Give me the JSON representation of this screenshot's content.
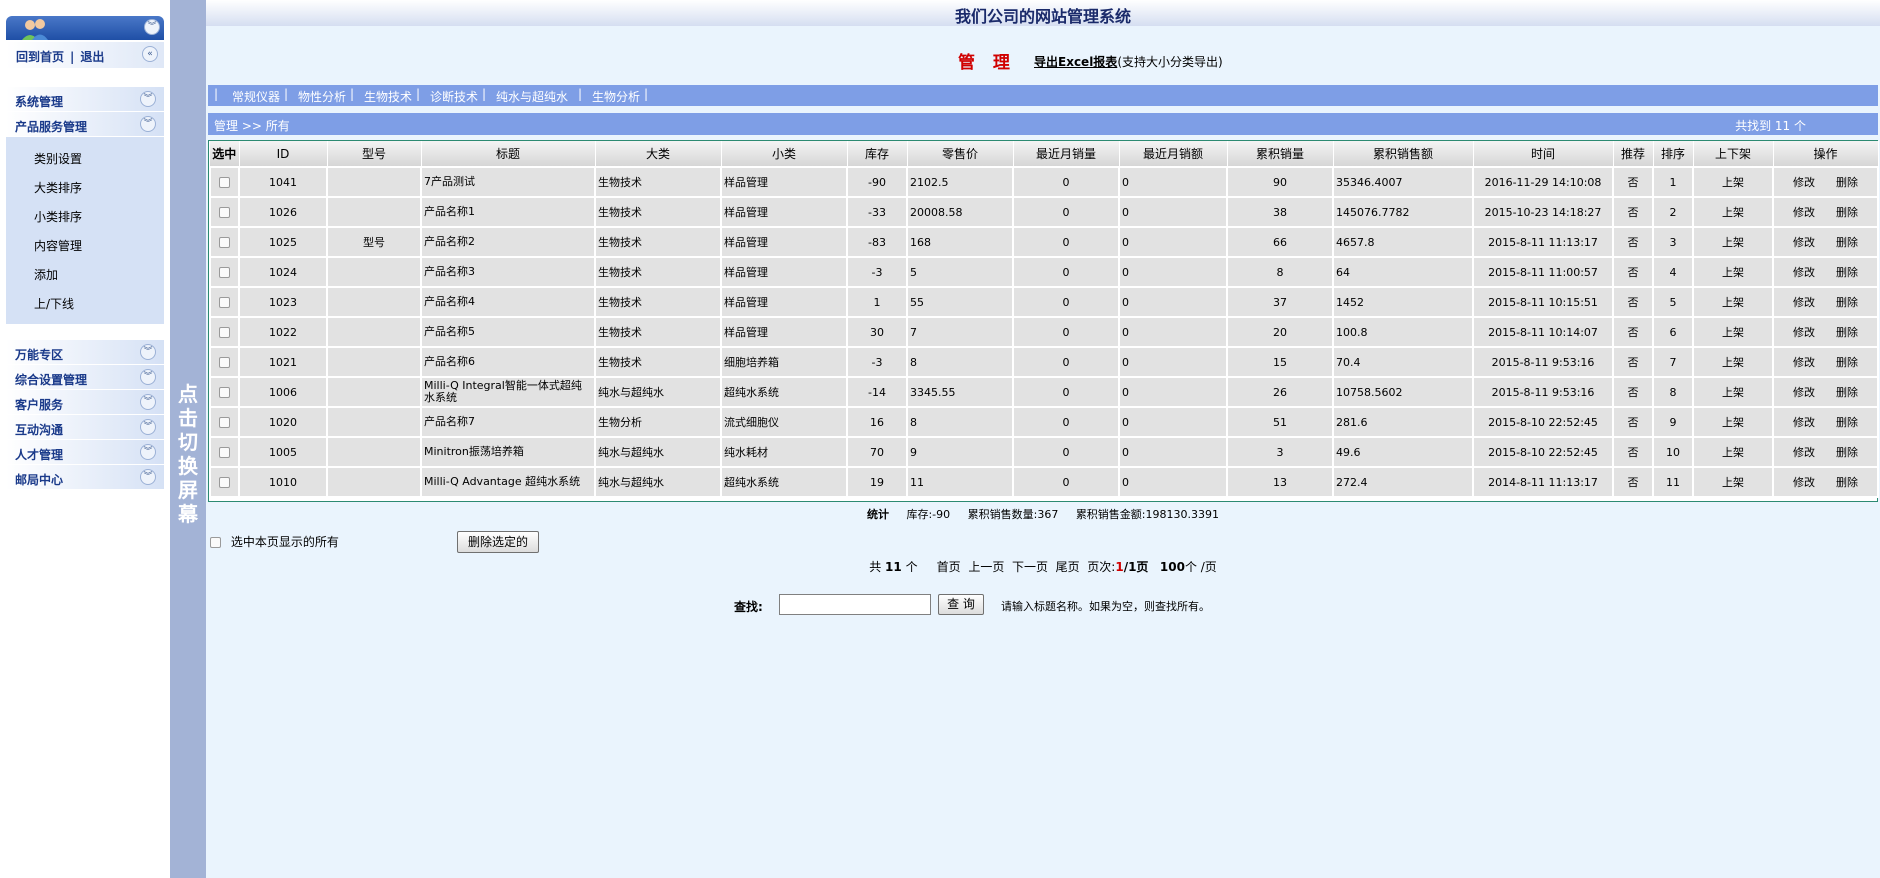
{
  "sidebar": {
    "home_link": "回到首页",
    "logout_link": "退出",
    "divider": "|",
    "menus_top": [
      "系统管理",
      "产品服务管理"
    ],
    "sub_items": [
      "类别设置",
      "大类排序",
      "小类排序",
      "内容管理",
      "添加",
      "上/下线"
    ],
    "menus_bottom": [
      "万能专区",
      "综合设置管理",
      "客户服务",
      "互动沟通",
      "人才管理",
      "邮局中心"
    ]
  },
  "toggle_bar": {
    "text": "点击切换屏幕"
  },
  "site_title": "我们公司的网站管理系统",
  "page_head": {
    "title": "管 理",
    "excel_link": "导出Excel报表",
    "excel_note": "(支持大小分类导出)"
  },
  "categories": [
    "常规仪器",
    "物性分析",
    "生物技术",
    "诊断技术",
    "纯水与超纯水",
    "生物分析"
  ],
  "breadcrumb": {
    "text": "管理 >> 所有",
    "found": "共找到 11 个"
  },
  "table": {
    "headers": [
      "选中",
      "ID",
      "型号",
      "标题",
      "大类",
      "小类",
      "库存",
      "零售价",
      "最近月销量",
      "最近月销额",
      "累积销量",
      "累积销售额",
      "时间",
      "推荐",
      "排序",
      "上下架",
      "操作"
    ],
    "rows": [
      {
        "id": "1041",
        "model": "",
        "title": "7产品测试",
        "big": "生物技术",
        "small": "样品管理",
        "stock": "-90",
        "price": "2102.5",
        "mqty": "0",
        "mamt": "0",
        "tqty": "90",
        "tamt": "35346.4007",
        "time": "2016-11-29 14:10:08",
        "rec": "否",
        "sort": "1",
        "shelf": "上架",
        "edit": "修改",
        "del": "删除"
      },
      {
        "id": "1026",
        "model": "",
        "title": "产品名称1",
        "big": "生物技术",
        "small": "样品管理",
        "stock": "-33",
        "price": "20008.58",
        "mqty": "0",
        "mamt": "0",
        "tqty": "38",
        "tamt": "145076.7782",
        "time": "2015-10-23 14:18:27",
        "rec": "否",
        "sort": "2",
        "shelf": "上架",
        "edit": "修改",
        "del": "删除"
      },
      {
        "id": "1025",
        "model": "型号",
        "title": "产品名称2",
        "big": "生物技术",
        "small": "样品管理",
        "stock": "-83",
        "price": "168",
        "mqty": "0",
        "mamt": "0",
        "tqty": "66",
        "tamt": "4657.8",
        "time": "2015-8-11 11:13:17",
        "rec": "否",
        "sort": "3",
        "shelf": "上架",
        "edit": "修改",
        "del": "删除"
      },
      {
        "id": "1024",
        "model": "",
        "title": "产品名称3",
        "big": "生物技术",
        "small": "样品管理",
        "stock": "-3",
        "price": "5",
        "mqty": "0",
        "mamt": "0",
        "tqty": "8",
        "tamt": "64",
        "time": "2015-8-11 11:00:57",
        "rec": "否",
        "sort": "4",
        "shelf": "上架",
        "edit": "修改",
        "del": "删除"
      },
      {
        "id": "1023",
        "model": "",
        "title": "产品名称4",
        "big": "生物技术",
        "small": "样品管理",
        "stock": "1",
        "price": "55",
        "mqty": "0",
        "mamt": "0",
        "tqty": "37",
        "tamt": "1452",
        "time": "2015-8-11 10:15:51",
        "rec": "否",
        "sort": "5",
        "shelf": "上架",
        "edit": "修改",
        "del": "删除"
      },
      {
        "id": "1022",
        "model": "",
        "title": "产品名称5",
        "big": "生物技术",
        "small": "样品管理",
        "stock": "30",
        "price": "7",
        "mqty": "0",
        "mamt": "0",
        "tqty": "20",
        "tamt": "100.8",
        "time": "2015-8-11 10:14:07",
        "rec": "否",
        "sort": "6",
        "shelf": "上架",
        "edit": "修改",
        "del": "删除"
      },
      {
        "id": "1021",
        "model": "",
        "title": "产品名称6",
        "big": "生物技术",
        "small": "细胞培养箱",
        "stock": "-3",
        "price": "8",
        "mqty": "0",
        "mamt": "0",
        "tqty": "15",
        "tamt": "70.4",
        "time": "2015-8-11 9:53:16",
        "rec": "否",
        "sort": "7",
        "shelf": "上架",
        "edit": "修改",
        "del": "删除"
      },
      {
        "id": "1006",
        "model": "",
        "title": "Milli-Q Integral智能一体式超纯水系统",
        "big": "纯水与超纯水",
        "small": "超纯水系统",
        "stock": "-14",
        "price": "3345.55",
        "mqty": "0",
        "mamt": "0",
        "tqty": "26",
        "tamt": "10758.5602",
        "time": "2015-8-11 9:53:16",
        "rec": "否",
        "sort": "8",
        "shelf": "上架",
        "edit": "修改",
        "del": "删除"
      },
      {
        "id": "1020",
        "model": "",
        "title": "产品名称7",
        "big": "生物分析",
        "small": "流式细胞仪",
        "stock": "16",
        "price": "8",
        "mqty": "0",
        "mamt": "0",
        "tqty": "51",
        "tamt": "281.6",
        "time": "2015-8-10 22:52:45",
        "rec": "否",
        "sort": "9",
        "shelf": "上架",
        "edit": "修改",
        "del": "删除"
      },
      {
        "id": "1005",
        "model": "",
        "title": "Minitron振荡培养箱",
        "big": "纯水与超纯水",
        "small": "纯水耗材",
        "stock": "70",
        "price": "9",
        "mqty": "0",
        "mamt": "0",
        "tqty": "3",
        "tamt": "49.6",
        "time": "2015-8-10 22:52:45",
        "rec": "否",
        "sort": "10",
        "shelf": "上架",
        "edit": "修改",
        "del": "删除"
      },
      {
        "id": "1010",
        "model": "",
        "title": "Milli-Q Advantage 超纯水系统",
        "big": "纯水与超纯水",
        "small": "超纯水系统",
        "stock": "19",
        "price": "11",
        "mqty": "0",
        "mamt": "0",
        "tqty": "13",
        "tamt": "272.4",
        "time": "2014-8-11 11:13:17",
        "rec": "否",
        "sort": "11",
        "shelf": "上架",
        "edit": "修改",
        "del": "删除"
      }
    ]
  },
  "stats": {
    "label": "统计",
    "stock": "库存:-90",
    "total_qty": "累积销售数量:367",
    "total_amt": "累积销售金额:198130.3391"
  },
  "select_all_label": "选中本页显示的所有",
  "delete_button": "删除选定的",
  "pager": {
    "total_prefix": "共",
    "total": "11",
    "total_suffix": "个",
    "first": "首页",
    "prev": "上一页",
    "next": "下一页",
    "last": "尾页",
    "page_label": "页次:",
    "page_current": "1",
    "page_total": "/1页",
    "per_page": "100",
    "per_page_suffix": "个 /页"
  },
  "search": {
    "label": "查找:",
    "value": "",
    "button": "查 询",
    "hint": "请输入标题名称。如果为空，则查找所有。"
  },
  "colors": {
    "accent_bar": "#7e9ee6",
    "sidebar_blue": "#1f4fa6",
    "toggle_bar": "#a3b3d6",
    "title_red": "#d00000",
    "main_bg": "#eaf4fd"
  }
}
